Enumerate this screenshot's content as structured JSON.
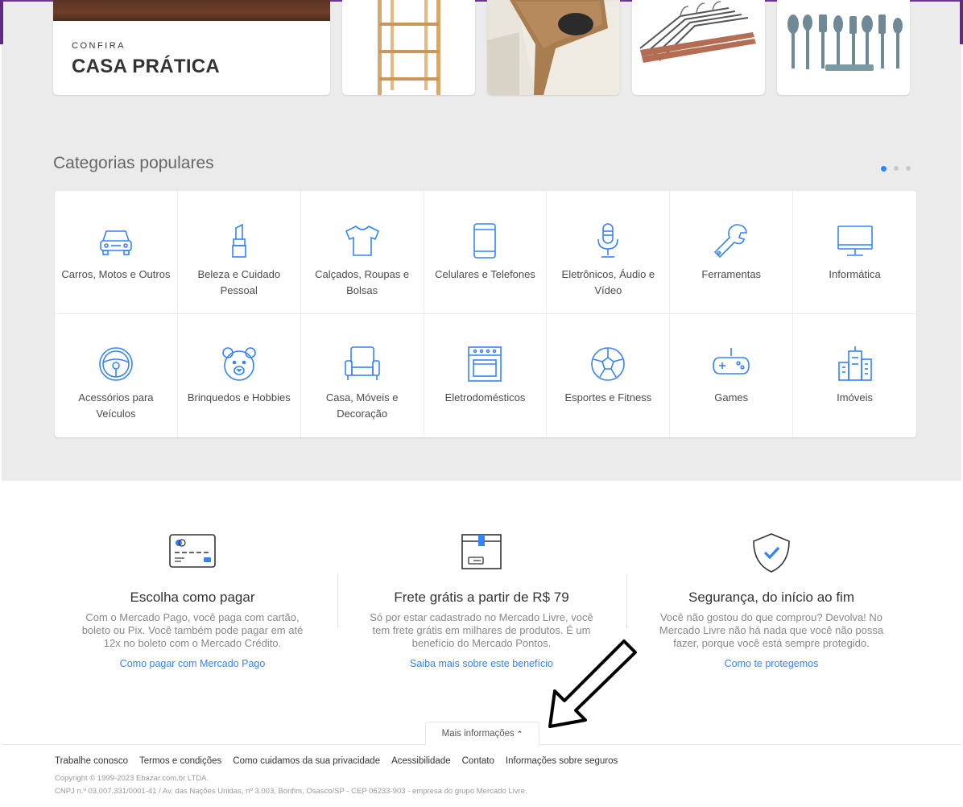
{
  "promo": {
    "kicker": "CONFIRA",
    "title": "CASA PRÁTICA"
  },
  "thumbnails": [
    {
      "icon": "wooden-shelf-image"
    },
    {
      "icon": "sofa-arm-tray-image"
    },
    {
      "icon": "hangers-image"
    },
    {
      "icon": "kitchen-utensils-image"
    }
  ],
  "categories": {
    "title": "Categorias populares",
    "items": [
      {
        "label": "Carros, Motos e Outros",
        "icon": "car-icon"
      },
      {
        "label": "Beleza e Cuidado Pessoal",
        "icon": "lipstick-icon"
      },
      {
        "label": "Calçados, Roupas e Bolsas",
        "icon": "tshirt-icon"
      },
      {
        "label": "Celulares e Telefones",
        "icon": "phone-icon"
      },
      {
        "label": "Eletrônicos, Áudio e Vídeo",
        "icon": "microphone-icon"
      },
      {
        "label": "Ferramentas",
        "icon": "wrench-icon"
      },
      {
        "label": "Informática",
        "icon": "monitor-icon"
      },
      {
        "label": "Acessórios para Veículos",
        "icon": "steering-wheel-icon"
      },
      {
        "label": "Brinquedos e Hobbies",
        "icon": "teddy-bear-icon"
      },
      {
        "label": "Casa, Móveis e Decoração",
        "icon": "armchair-icon"
      },
      {
        "label": "Eletrodomésticos",
        "icon": "oven-icon"
      },
      {
        "label": "Esportes e Fitness",
        "icon": "soccer-ball-icon"
      },
      {
        "label": "Games",
        "icon": "gamepad-icon"
      },
      {
        "label": "Imóveis",
        "icon": "buildings-icon"
      }
    ]
  },
  "features": [
    {
      "title": "Escolha como pagar",
      "text": "Com o Mercado Pago, você paga com cartão, boleto ou Pix. Você também pode pagar em até 12x no boleto com o Mercado Crédito.",
      "link": "Como pagar com Mercado Pago",
      "icon": "credit-card-icon"
    },
    {
      "title": "Frete grátis a partir de R$ 79",
      "text": "Só por estar cadastrado no Mercado Livre, você tem frete grátis em milhares de produtos. É um benefício do Mercado Pontos.",
      "link": "Saiba mais sobre este benefício",
      "icon": "box-icon"
    },
    {
      "title": "Segurança, do início ao fim",
      "text": "Você não gostou do que comprou? Devolva! No Mercado Livre não há nada que você não possa fazer, porque você está sempre protegido.",
      "link": "Como te protegemos",
      "icon": "shield-check-icon"
    }
  ],
  "footer": {
    "more_info": "Mais informações",
    "links": [
      "Trabalhe conosco",
      "Termos e condições",
      "Como cuidamos da sua privacidade",
      "Acessibilidade",
      "Contato",
      "Informações sobre seguros"
    ],
    "copyright": "Copyright © 1999-2023 Ebazar.com.br LTDA.",
    "cnpj": "CNPJ n.º 03.007.331/0001-41 / Av. das Nações Unidas, nº 3.003, Bonfim, Osasco/SP - CEP 06233-903 - empresa do grupo Mercado Livre."
  },
  "colors": {
    "accent": "#3483fa",
    "background": "#ebebeb",
    "icon": "#3483fa"
  }
}
